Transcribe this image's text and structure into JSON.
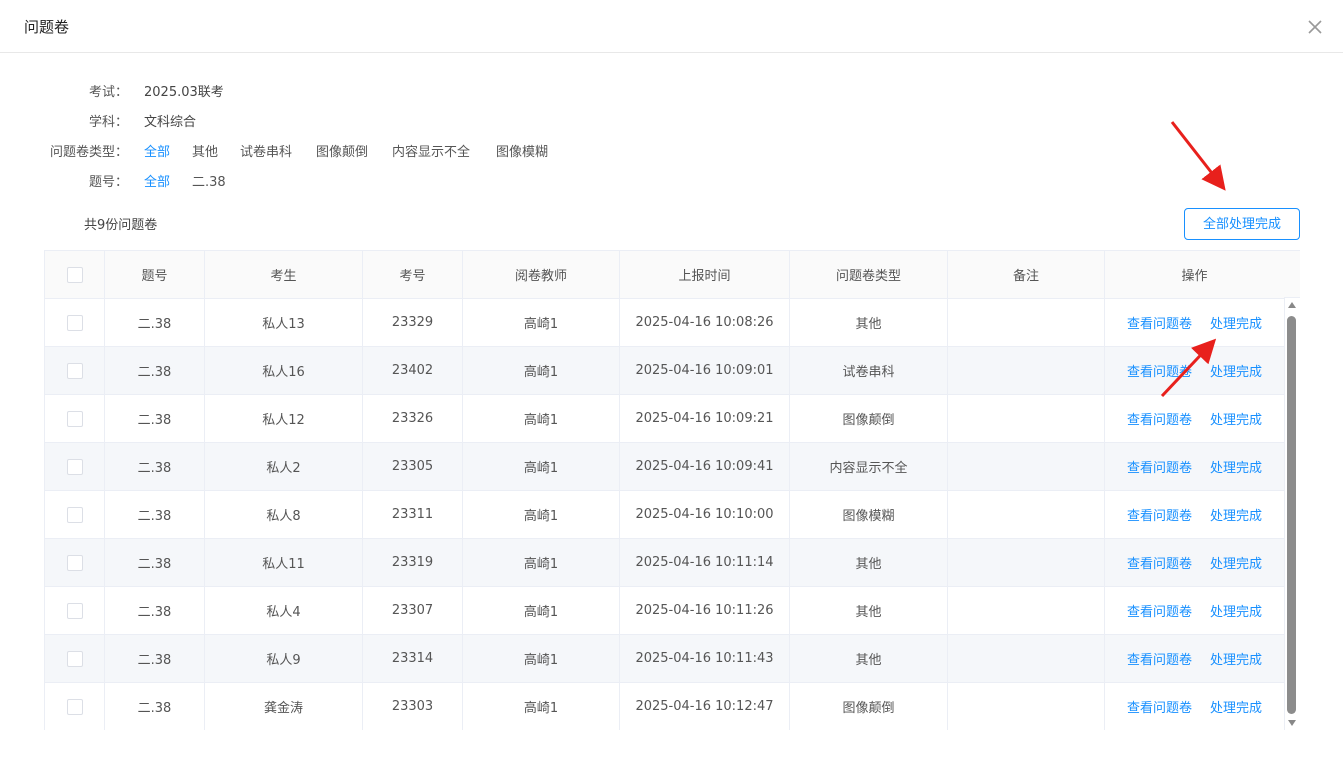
{
  "dialog": {
    "title": "问题卷"
  },
  "info": {
    "exam_label": "考试：",
    "exam_value": "2025.03联考",
    "subject_label": "学科：",
    "subject_value": "文科综合",
    "type_label": "问题卷类型：",
    "type_filters": [
      "全部",
      "其他",
      "试卷串科",
      "图像颠倒",
      "内容显示不全",
      "图像模糊"
    ],
    "question_label": "题号：",
    "question_filters": [
      "全部",
      "二.38"
    ]
  },
  "summary": {
    "total": "共9份问题卷"
  },
  "toolbar": {
    "all_done_label": "全部处理完成"
  },
  "table": {
    "headers": [
      "题号",
      "考生",
      "考号",
      "阅卷教师",
      "上报时间",
      "问题卷类型",
      "备注",
      "操作"
    ],
    "rows": [
      {
        "question": "二.38",
        "student": "私人13",
        "id": "23329",
        "teacher": "高崎1",
        "time": "2025-04-16 10:08:26",
        "type": "其他",
        "note": ""
      },
      {
        "question": "二.38",
        "student": "私人16",
        "id": "23402",
        "teacher": "高崎1",
        "time": "2025-04-16 10:09:01",
        "type": "试卷串科",
        "note": ""
      },
      {
        "question": "二.38",
        "student": "私人12",
        "id": "23326",
        "teacher": "高崎1",
        "time": "2025-04-16 10:09:21",
        "type": "图像颠倒",
        "note": ""
      },
      {
        "question": "二.38",
        "student": "私人2",
        "id": "23305",
        "teacher": "高崎1",
        "time": "2025-04-16 10:09:41",
        "type": "内容显示不全",
        "note": ""
      },
      {
        "question": "二.38",
        "student": "私人8",
        "id": "23311",
        "teacher": "高崎1",
        "time": "2025-04-16 10:10:00",
        "type": "图像模糊",
        "note": ""
      },
      {
        "question": "二.38",
        "student": "私人11",
        "id": "23319",
        "teacher": "高崎1",
        "time": "2025-04-16 10:11:14",
        "type": "其他",
        "note": ""
      },
      {
        "question": "二.38",
        "student": "私人4",
        "id": "23307",
        "teacher": "高崎1",
        "time": "2025-04-16 10:11:26",
        "type": "其他",
        "note": ""
      },
      {
        "question": "二.38",
        "student": "私人9",
        "id": "23314",
        "teacher": "高崎1",
        "time": "2025-04-16 10:11:43",
        "type": "其他",
        "note": ""
      },
      {
        "question": "二.38",
        "student": "龚金涛",
        "id": "23303",
        "teacher": "高崎1",
        "time": "2025-04-16 10:12:47",
        "type": "图像颠倒",
        "note": ""
      }
    ],
    "actions": {
      "view": "查看问题卷",
      "done": "处理完成"
    }
  },
  "colors": {
    "accent": "#1890ff",
    "annotation_arrow": "#e8201c",
    "stripe": "#f5f7fa"
  },
  "icons": {
    "close": "close-icon"
  }
}
